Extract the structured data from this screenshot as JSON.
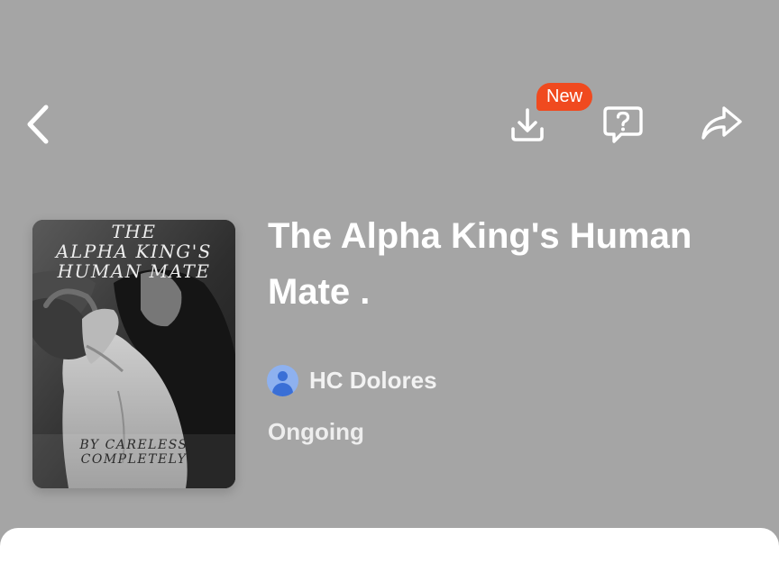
{
  "header": {
    "icons": {
      "back": "chevron-left-icon",
      "download": "download-icon",
      "faq": "help-icon",
      "share": "share-icon"
    },
    "new_badge": "New",
    "badge_color": "#f04a1f"
  },
  "book": {
    "title": "The Alpha King's Human Mate .",
    "author": "HC Dolores",
    "status": "Ongoing",
    "cover": {
      "title": "THE\nALPHA KING'S\nHUMAN MATE",
      "author": "BY CARELESS\nCOMPLETELY"
    }
  },
  "colors": {
    "background": "#a5a5a5",
    "text": "#ffffff",
    "avatar": "#8eb1ef",
    "avatar_figure": "#3a6fd6",
    "sheet": "#ffffff"
  }
}
